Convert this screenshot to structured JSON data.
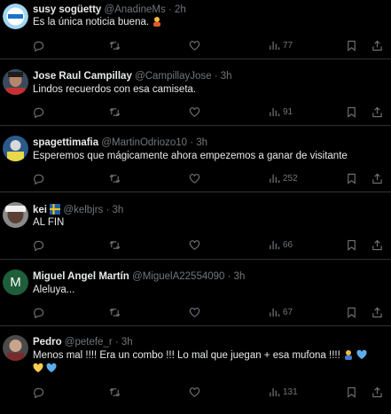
{
  "tweets": [
    {
      "name": "susy sogüetty",
      "handle": "@AnadineMs",
      "time": "· 2h",
      "text": "Es la única noticia buena.",
      "views": "77"
    },
    {
      "name": "Jose Raul Campillay",
      "handle": "@CampillayJose",
      "time": "· 3h",
      "text": "Lindos recuerdos con esa camiseta.",
      "views": "91"
    },
    {
      "name": "spagettimafia",
      "handle": "@MartinOdriozo10",
      "time": "· 3h",
      "text": "Esperemos que mágicamente ahora empezemos a ganar de visitante",
      "views": "252"
    },
    {
      "name": "kei",
      "handle": "@kelbjrs",
      "time": "· 3h",
      "text": "AL FIN",
      "views": "66"
    },
    {
      "name": "Miguel Angel Martín",
      "handle": "@MiguelA22554090",
      "time": "· 3h",
      "text": "Aleluya...",
      "views": "67",
      "avatar_letter": "M"
    },
    {
      "name": "Pedro",
      "handle": "@petefe_r",
      "time": "· 3h",
      "text": "Menos mal !!!! Era un combo !!! Lo mal que juegan +  esa mufona !!!!",
      "views": "131"
    }
  ],
  "colors": {
    "bg": "#000000",
    "text": "#e7e9ea",
    "muted": "#71767b",
    "border": "#2f3336",
    "green_avatar": "#1f5e3a"
  },
  "icons": [
    "reply-icon",
    "retweet-icon",
    "like-icon",
    "views-icon",
    "bookmark-icon",
    "share-icon"
  ]
}
